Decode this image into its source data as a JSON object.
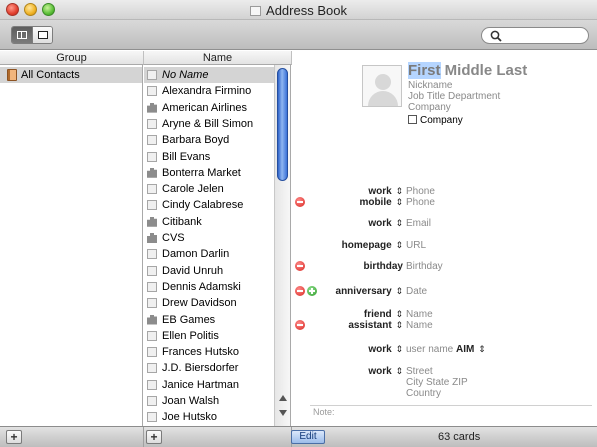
{
  "window": {
    "title": "Address Book"
  },
  "toolbar": {
    "view_buttons": [
      "card-and-list-view",
      "card-only-view"
    ],
    "search": {
      "value": "",
      "placeholder": ""
    }
  },
  "columns": {
    "group": "Group",
    "name": "Name"
  },
  "groups": [
    {
      "label": "All Contacts",
      "icon": "address-book-icon",
      "selected": true
    }
  ],
  "names": [
    {
      "label": "No Name",
      "type": "person",
      "selected": true,
      "italic": true
    },
    {
      "label": "Alexandra Firmino",
      "type": "person"
    },
    {
      "label": "American Airlines",
      "type": "company"
    },
    {
      "label": "Aryne & Bill Simon",
      "type": "person"
    },
    {
      "label": "Barbara Boyd",
      "type": "person"
    },
    {
      "label": "Bill Evans",
      "type": "person"
    },
    {
      "label": "Bonterra Market",
      "type": "company"
    },
    {
      "label": "Carole Jelen",
      "type": "person"
    },
    {
      "label": "Cindy Calabrese",
      "type": "person"
    },
    {
      "label": "Citibank",
      "type": "company"
    },
    {
      "label": "CVS",
      "type": "company"
    },
    {
      "label": "Damon Darlin",
      "type": "person"
    },
    {
      "label": "David Unruh",
      "type": "person"
    },
    {
      "label": "Dennis Adamski",
      "type": "person"
    },
    {
      "label": "Drew Davidson",
      "type": "person"
    },
    {
      "label": "EB Games",
      "type": "company"
    },
    {
      "label": "Ellen Politis",
      "type": "person"
    },
    {
      "label": "Frances Hutsko",
      "type": "person"
    },
    {
      "label": "J.D. Biersdorfer",
      "type": "person"
    },
    {
      "label": "Janice Hartman",
      "type": "person"
    },
    {
      "label": "Joan Walsh",
      "type": "person"
    },
    {
      "label": "Joe Hutsko",
      "type": "person"
    }
  ],
  "card": {
    "first": "First",
    "middle_last": " Middle Last",
    "nickname": "Nickname",
    "job_line": "Job Title Department",
    "company": "Company",
    "company_checkbox": "Company",
    "phone_work_label": "work",
    "phone_work_ph": "Phone",
    "phone_mobile_label": "mobile",
    "phone_mobile_ph": "Phone",
    "email_label": "work",
    "email_ph": "Email",
    "url_label": "homepage",
    "url_ph": "URL",
    "birthday_label": "birthday",
    "birthday_ph": "Birthday",
    "anniversary_label": "anniversary",
    "anniversary_ph": "Date",
    "friend_label": "friend",
    "friend_ph": "Name",
    "assistant_label": "assistant",
    "assistant_ph": "Name",
    "im_label": "work",
    "im_ph": "user name",
    "im_service": "AIM",
    "address_label": "work",
    "street_ph": "Street",
    "city_line": "City  State  ZIP",
    "country_ph": "Country",
    "note_label": "Note:"
  },
  "bottombar": {
    "edit": "Edit",
    "count": "63 cards"
  },
  "chevron": "⇕",
  "colors": {
    "selection": "#d4d4d4",
    "name_highlight": "#b5d5ff",
    "scroll_thumb": "#3b72d8"
  }
}
